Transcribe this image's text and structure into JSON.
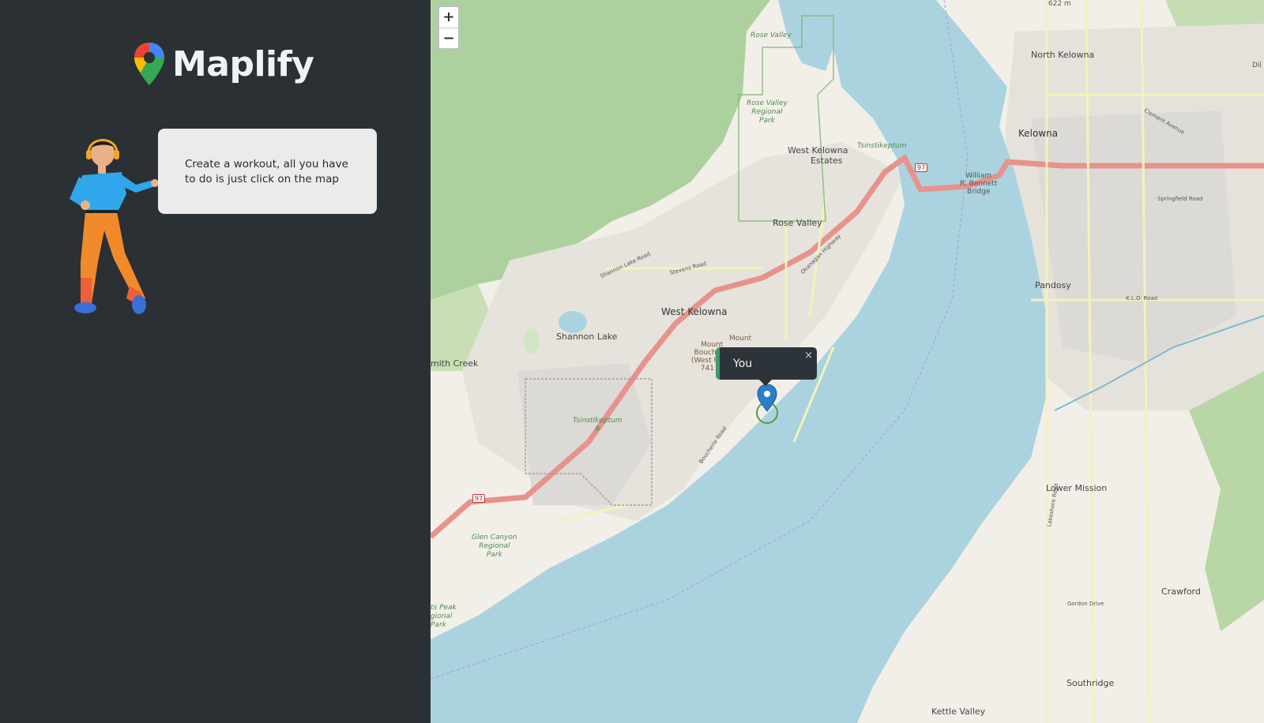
{
  "app": {
    "name": "Maplify",
    "logo_icon": "map-pin-icon"
  },
  "sidebar": {
    "message": "Create a workout, all you have to do is just click on the map",
    "illustration": "person-with-headphones-illustration"
  },
  "map": {
    "zoom_in_label": "+",
    "zoom_out_label": "−",
    "popup": {
      "text": "You",
      "close_label": "×"
    },
    "labels": {
      "elevation_top": "622 m",
      "north_kelowna": "North Kelowna",
      "kelowna": "Kelowna",
      "west_kelowna_estates_1": "West Kelowna",
      "west_kelowna_estates_2": "Estates",
      "rose_valley": "Rose Valley",
      "rose_valley_park_1": "Rose Valley",
      "rose_valley_park_2": "Regional",
      "rose_valley_park_3": "Park",
      "rose_valley_top": "Rose Valley",
      "tsinstikeptum_1": "Tsinstikeptum",
      "tsinstikeptum_2": "Tsinstikeptum",
      "tsinstikeptum_2_num": "9",
      "bridge_1": "William",
      "bridge_2": "R. Bennett",
      "bridge_3": "Bridge",
      "west_kelowna": "West Kelowna",
      "shannon_lake": "Shannon Lake",
      "smith_creek": "mith Creek",
      "mount_boucherie_1": "Mount",
      "mount_boucherie_2": "Boucherie",
      "mount_boucherie_3": "(West Face)",
      "mount_boucherie_4": "741 m",
      "mount_small": "Mount",
      "pandosy": "Pandosy",
      "lower_mission": "Lower Mission",
      "crawford": "Crawford",
      "southridge": "Southridge",
      "kettle_valley": "Kettle Valley",
      "glen_canyon_1": "Glen Canyon",
      "glen_canyon_2": "Regional",
      "glen_canyon_3": "Park",
      "tits_peak_1": "ts Peak",
      "tits_peak_2": "gional",
      "tits_peak_3": "Park",
      "dil": "Dil",
      "hwy_97_a": "97",
      "hwy_97_b": "97",
      "okanagan_hwy": "Okanagan Highway",
      "shannon_lake_road": "Shannon Lake Road",
      "stevens_road": "Stevens Road",
      "boucherie_road": "Boucherie Road",
      "kld_road": "K.L.O. Road",
      "springfield_road": "Springfield Road",
      "gordon_drive": "Gordon Drive",
      "lakeshore_road": "Lakeshore Road",
      "clement_avenue": "Clement Avenue"
    },
    "colors": {
      "water": "#aad3df",
      "forest": "#add19e",
      "highway": "#e8928c",
      "land": "#f2efe9",
      "urban": "#e0dfdf"
    }
  }
}
